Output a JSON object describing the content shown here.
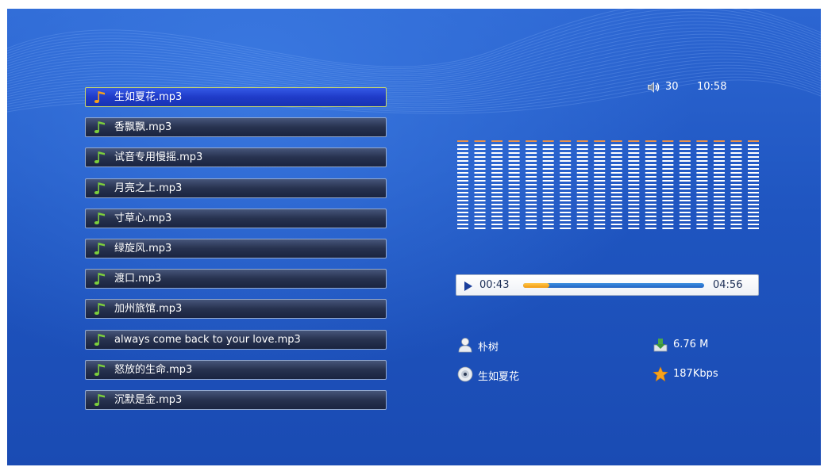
{
  "playlist": {
    "items": [
      {
        "name": "生如夏花.mp3"
      },
      {
        "name": "香飘飘.mp3"
      },
      {
        "name": "试音专用慢摇.mp3"
      },
      {
        "name": "月亮之上.mp3"
      },
      {
        "name": "寸草心.mp3"
      },
      {
        "name": "绿旋风.mp3"
      },
      {
        "name": "渡口.mp3"
      },
      {
        "name": "加州旅馆.mp3"
      },
      {
        "name": "always come back to your love.mp3"
      },
      {
        "name": "怒放的生命.mp3"
      },
      {
        "name": "沉默是金.mp3"
      }
    ],
    "selected_index": 0
  },
  "status": {
    "volume_icon": "speaker-icon",
    "volume": "30",
    "clock": "10:58"
  },
  "player": {
    "current_time": "00:43",
    "total_time": "04:56",
    "progress_fraction": 0.145,
    "play_icon": "play-icon"
  },
  "spectrum": {
    "bars": 18,
    "levels": [
      1,
      1,
      1,
      1,
      1,
      1,
      1,
      1,
      1,
      1,
      1,
      1,
      1,
      1,
      1,
      1,
      1,
      1
    ],
    "bar_color": "#ffffff",
    "peak_color": "#e8914a"
  },
  "track_info": {
    "artist": "朴树",
    "album": "生如夏花",
    "size": "6.76 M",
    "bitrate": "187Kbps",
    "artist_icon": "user-icon",
    "album_icon": "disc-icon",
    "size_icon": "download-icon",
    "bitrate_icon": "star-icon"
  },
  "colors": {
    "background": "#1f55c0",
    "selected_item": "#1f3bc8",
    "item": "#27324f",
    "progress_fill": "#f29a10",
    "progress_track": "#2a74d4"
  }
}
